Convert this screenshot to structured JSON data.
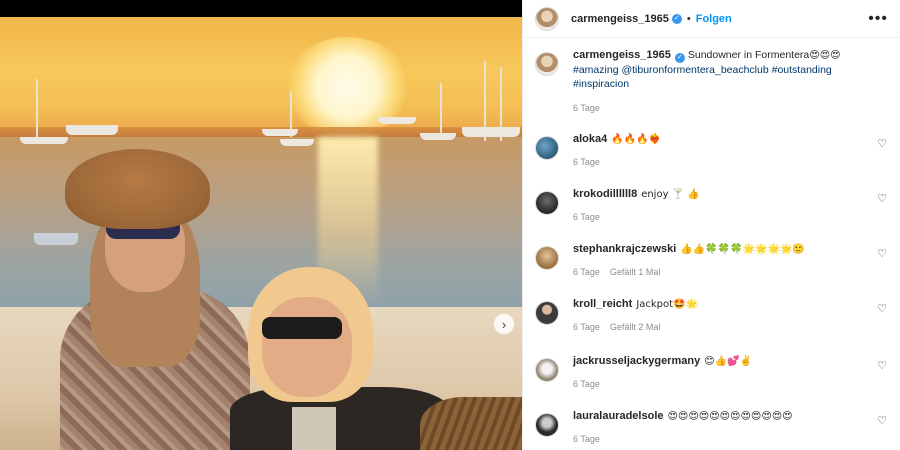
{
  "post": {
    "author": "carmengeiss_1965",
    "follow_label": "Folgen",
    "separator": "•",
    "more_icon": "more-horizontal-icon",
    "next_icon": "chevron-right-icon"
  },
  "caption": {
    "username": "carmengeiss_1965",
    "text_start": "Sundowner in Formentera",
    "emojis_1": "😍😍😍",
    "hashtag_amazing": "#amazing",
    "mention": "@tiburonformentera_beachclub",
    "hashtag_outstanding": "#outstanding",
    "hashtag_inspiracion": "#inspiracion",
    "time": "6 Tage"
  },
  "comments": [
    {
      "username": "aloka4",
      "text": "🔥🔥🔥❤️‍🔥",
      "time": "6 Tage",
      "likes": ""
    },
    {
      "username": "krokodillllll8",
      "text": "enjoy 🍸 👍",
      "time": "6 Tage",
      "likes": ""
    },
    {
      "username": "stephankrajczewski",
      "text": "👍👍🍀🍀🍀🌟🌟🌟🌟🙂",
      "time": "6 Tage",
      "likes": "Gefällt 1 Mal"
    },
    {
      "username": "kroll_reicht",
      "text": "Jackpot🤩🌟",
      "time": "6 Tage",
      "likes": "Gefällt 2 Mal"
    },
    {
      "username": "jackrusseljackygermany",
      "text": "😊👍💕✌️",
      "time": "6 Tage",
      "likes": ""
    },
    {
      "username": "lauralauradelsole",
      "text": "😍😍😍😍😍😍😍😍😍😍😍😍",
      "time": "6 Tage",
      "likes": ""
    }
  ],
  "colors": {
    "link": "#00376b",
    "follow": "#0095f6",
    "verified": "#3797f0",
    "meta": "#8e8e8e"
  }
}
